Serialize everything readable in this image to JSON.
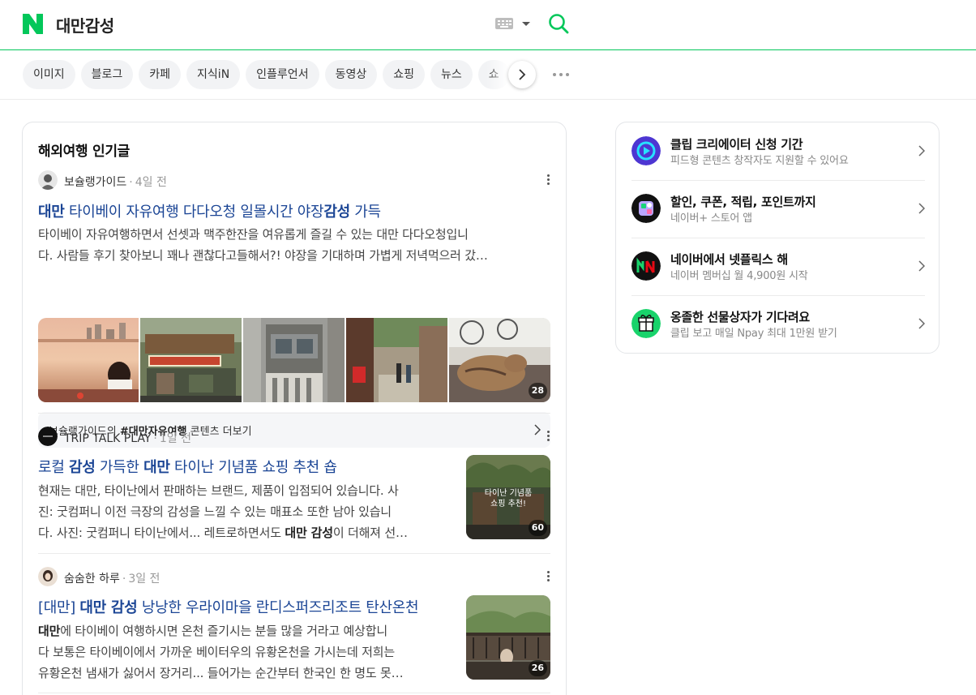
{
  "header": {
    "logo_alt": "N",
    "query": "대만감성",
    "brand_color": "#03c75a"
  },
  "tabs": [
    {
      "label": "이미지"
    },
    {
      "label": "블로그"
    },
    {
      "label": "카페"
    },
    {
      "label": "지식iN"
    },
    {
      "label": "인플루언서"
    },
    {
      "label": "동영상"
    },
    {
      "label": "쇼핑"
    },
    {
      "label": "뉴스"
    },
    {
      "label": "쇼"
    }
  ],
  "main": {
    "section_title": "해외여행 인기글",
    "posts": [
      {
        "author": "보슐랭가이드",
        "time": "4일 전",
        "title_parts": [
          "대만",
          " 타이베이 자유여행 다다오청 일몰시간 야장",
          "감성",
          " 가득"
        ],
        "desc_line1": "타이베이 자유여행하면서 선셋과 맥주한잔을 여유롭게 즐길 수 있는 대만 다다오청입니",
        "desc_line2": "다. 사람들 후기 찾아보니 꽤나 괜찮다고들해서?! 야장을 기대하며 가볍게 저녁먹으러 갔…",
        "image_count": "28",
        "more_prefix": "보슐랭가이드의 ",
        "more_tag": "#대만자유여행",
        "more_suffix": " 콘텐츠 더보기"
      },
      {
        "author": "TRIP TALK PLAY",
        "time": "1일 전",
        "title_parts": [
          "로컬 ",
          "감성",
          " 가득한 ",
          "대만",
          " 타이난 기념품 쇼핑 추천 숍"
        ],
        "desc_line1": "현재는 대만, 타이난에서 판매하는 브랜드, 제품이 입점되어 있습니다. 사",
        "desc_line2": "진: 굿컴퍼니 이전 극장의 감성을 느낄 수 있는 매표소 또한 남아 있습니",
        "desc_line3_a": "다. 사진: 굿컴퍼니 타이난에서... 레트로하면서도 ",
        "desc_line3_b": "대만 감성",
        "desc_line3_c": "이 더해져 선…",
        "thumb_text_1": "타이난 기념품",
        "thumb_text_2": "쇼핑 추천!",
        "image_count": "60"
      },
      {
        "author": "숨숨한 하루",
        "time": "3일 전",
        "title_parts": [
          "[대만] ",
          "대만 감성",
          " 낭낭한 우라이마을 란디스퍼즈리조트 탄산온천"
        ],
        "desc_line1_b": "대만",
        "desc_line1_c": "에 타이베이 여행하시면 온천 즐기시는 분들 많을 거라고 예상합니",
        "desc_line2": "다 보통은 타이베이에서 가까운 베이터우의 유황온천을 가시는데 저희는",
        "desc_line3": "유황온천 냄새가 싫어서 장거리... 들어가는 순간부터 한국인 한 명도 못…",
        "image_count": "26"
      }
    ]
  },
  "side": {
    "promos": [
      {
        "title": "클립 크리에이터 신청 기간",
        "sub": "피드형 콘텐츠 창작자도 지원할 수 있어요",
        "icon": "clip-icon",
        "color": "#5b3bd6"
      },
      {
        "title": "할인, 쿠폰, 적립, 포인트까지",
        "sub": "네이버+ 스토어 앱",
        "icon": "store-app-icon",
        "color": "#111111"
      },
      {
        "title": "네이버에서 넷플릭스 해",
        "sub": "네이버 멤버십 월 4,900원 시작",
        "icon": "netflix-icon",
        "color": "#111111"
      },
      {
        "title": "옹졸한 선물상자가 기다려요",
        "sub": "클립 보고 매일 Npay 최대 1만원 받기",
        "icon": "gift-icon",
        "color": "#19d36b"
      }
    ]
  }
}
